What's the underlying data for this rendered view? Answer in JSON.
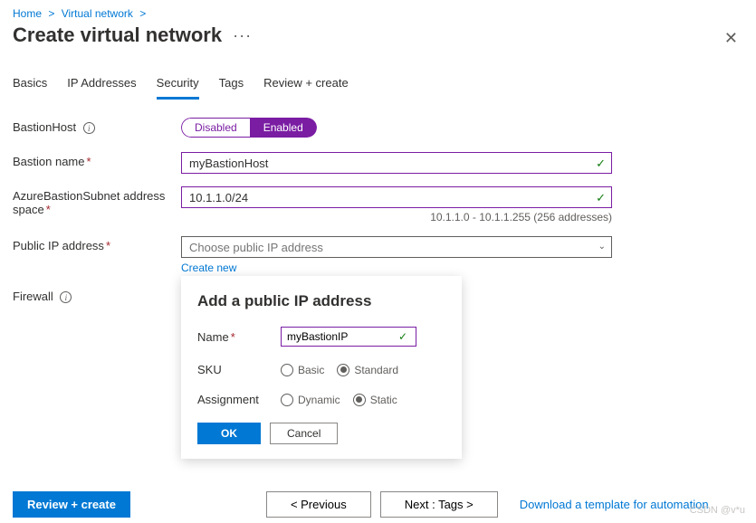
{
  "breadcrumb": {
    "home": "Home",
    "vn": "Virtual network"
  },
  "title": "Create virtual network",
  "close_glyph": "✕",
  "tabs": [
    "Basics",
    "IP Addresses",
    "Security",
    "Tags",
    "Review + create"
  ],
  "active_tab_index": 2,
  "form": {
    "bastion_host": {
      "label": "BastionHost",
      "disabled": "Disabled",
      "enabled": "Enabled"
    },
    "bastion_name": {
      "label": "Bastion name",
      "value": "myBastionHost"
    },
    "subnet": {
      "label": "AzureBastionSubnet address space",
      "value": "10.1.1.0/24",
      "hint": "10.1.1.0 - 10.1.1.255 (256 addresses)"
    },
    "pip": {
      "label": "Public IP address",
      "placeholder": "Choose public IP address",
      "create_new": "Create new"
    },
    "firewall": {
      "label": "Firewall"
    }
  },
  "popover": {
    "title": "Add a public IP address",
    "name_label": "Name",
    "name_value": "myBastionIP",
    "sku_label": "SKU",
    "sku_basic": "Basic",
    "sku_standard": "Standard",
    "assign_label": "Assignment",
    "assign_dynamic": "Dynamic",
    "assign_static": "Static",
    "ok": "OK",
    "cancel": "Cancel"
  },
  "footer": {
    "review": "Review + create",
    "previous": "< Previous",
    "next": "Next : Tags >",
    "download": "Download a template for automation"
  },
  "watermark": "CSDN @v*u"
}
